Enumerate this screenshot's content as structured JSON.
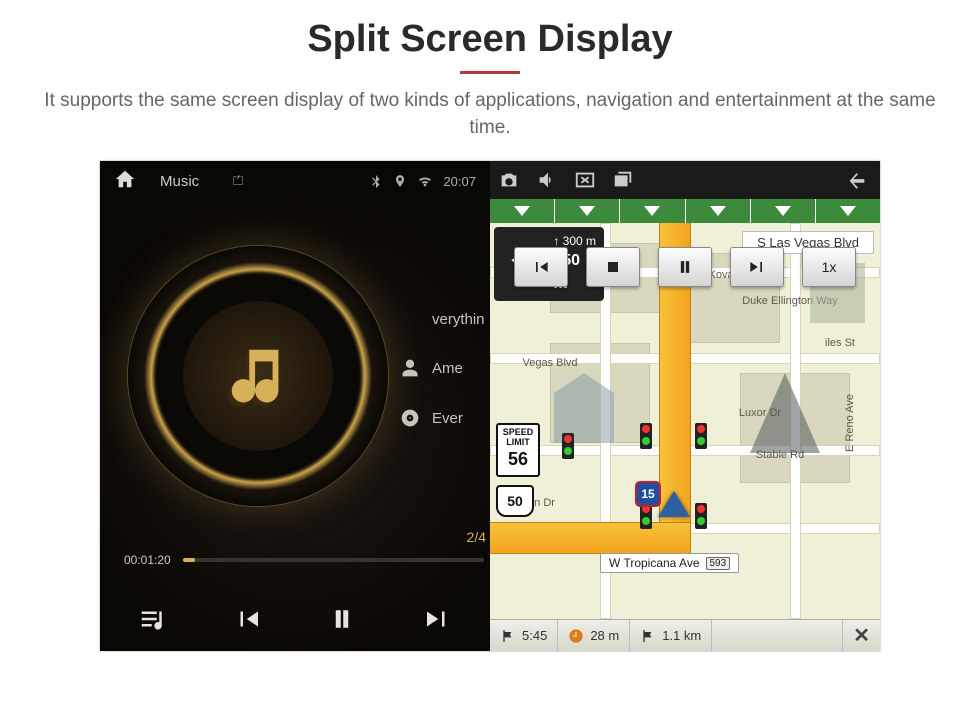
{
  "page": {
    "title": "Split Screen Display",
    "description": "It supports the same screen display of two kinds of applications, navigation and entertainment at the same time."
  },
  "music": {
    "header_label": "Music",
    "usb_label": "⏍",
    "status_time": "20:07",
    "song_title": "verythin",
    "artist": "Ame",
    "album": "Ever",
    "track_index": "2/4",
    "elapsed": "00:01:20"
  },
  "nav": {
    "arrows": 6,
    "turn_small": "300 m",
    "turn_big": "650 m",
    "current_banner": "S Las Vegas Blvd",
    "roads": {
      "koval": "Koval Ln",
      "duke": "Duke Ellington Way",
      "vegas": "Vegas Blvd",
      "iles": "iles St",
      "reno": "E Reno Ave",
      "luxor": "Luxor Dr",
      "stable": "Stable Rd",
      "rtin": "rtin Dr",
      "tropicana": "W Tropicana Ave",
      "tropicana_exit": "593"
    },
    "speed_limit_label": "SPEED LIMIT",
    "speed_limit": "56",
    "route_shield": "50",
    "interstate": "15",
    "btn_speed": "1x",
    "bottom": {
      "eta": "5:45",
      "remaining": "28 m",
      "next": "1.1 km"
    }
  }
}
